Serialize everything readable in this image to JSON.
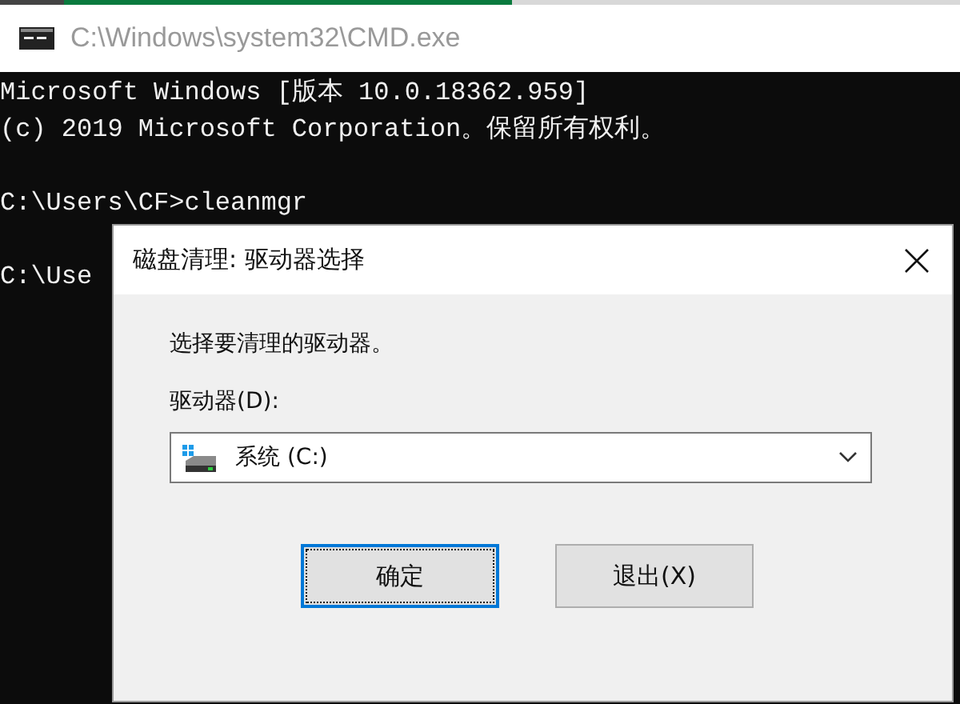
{
  "console_window": {
    "title": "C:\\Windows\\system32\\CMD.exe",
    "paragraphs": [
      [
        "Microsoft Windows [版本 10.0.18362.959]",
        "(c) 2019 Microsoft Corporation。保留所有权利。"
      ],
      [
        "C:\\Users\\CF>cleanmgr"
      ],
      [
        "C:\\Use"
      ]
    ]
  },
  "dialog": {
    "title": "磁盘清理: 驱动器选择",
    "prompt": "选择要清理的驱动器。",
    "drive_label": "驱动器(D):",
    "drive_select": {
      "value": "系统 (C:)"
    },
    "buttons": [
      {
        "label": "确定",
        "focused": true
      },
      {
        "label": "退出(X)",
        "focused": false
      }
    ]
  }
}
